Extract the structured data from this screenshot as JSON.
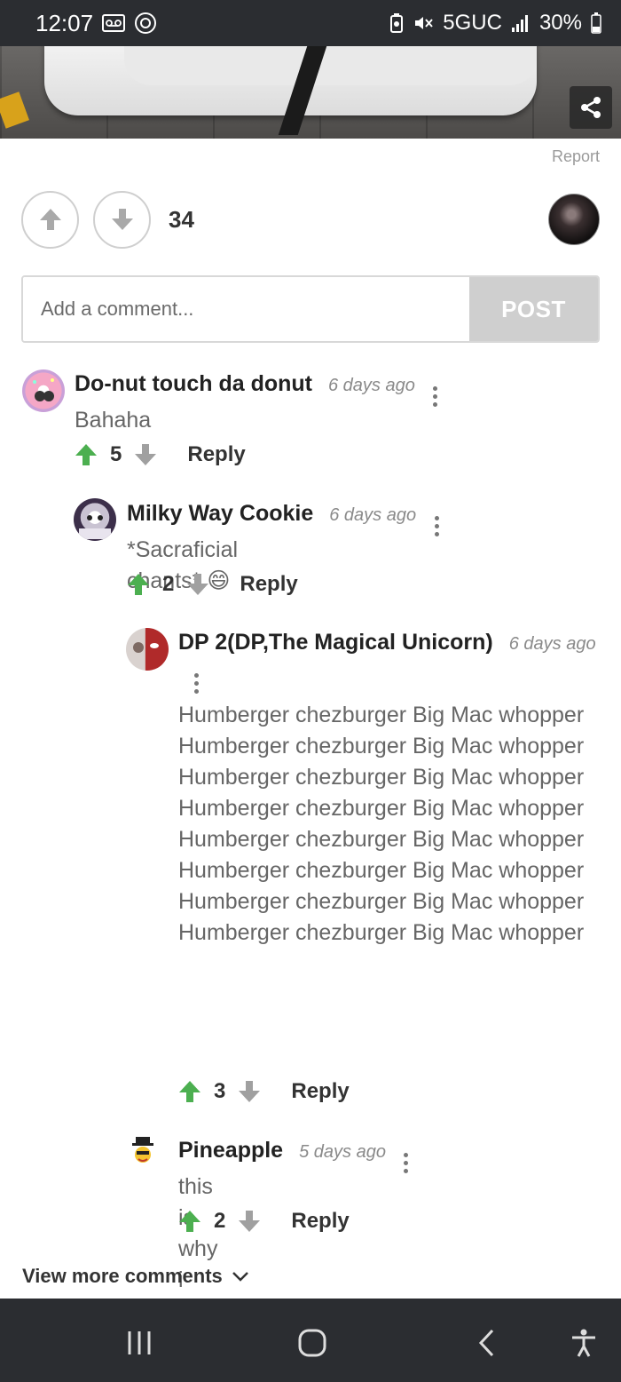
{
  "status_bar": {
    "time": "12:07",
    "network": "5GUC",
    "battery": "30%"
  },
  "post": {
    "report_label": "Report",
    "score": "34"
  },
  "comment_box": {
    "placeholder": "Add a comment...",
    "post_label": "POST"
  },
  "comments": [
    {
      "author": "Do-nut touch da donut",
      "time": "6 days ago",
      "text": "Bahaha",
      "votes": "5",
      "reply_label": "Reply"
    },
    {
      "author": "Milky Way Cookie",
      "time": "6 days ago",
      "text": "*Sacraficial chants* 😄",
      "votes": "2",
      "reply_label": "Reply"
    },
    {
      "author": "DP 2(DP,The Magical Unicorn)",
      "time": "6 days ago",
      "text": "Humberger chezburger Big Mac whopper Humberger chezburger Big Mac whopper Humberger chezburger Big Mac whopper Humberger chezburger Big Mac whopper Humberger chezburger Big Mac whopper Humberger chezburger Big Mac whopper Humberger chezburger Big Mac whopper Humberger chezburger Big Mac whopper",
      "votes": "3",
      "reply_label": "Reply"
    },
    {
      "author": "Pineapple",
      "time": "5 days ago",
      "text": "this is why i love bp",
      "votes": "2",
      "reply_label": "Reply"
    }
  ],
  "view_more_label": "View more comments",
  "colors": {
    "upvote_green": "#4caf50",
    "downvote_grey": "#a0a0a0",
    "system_bar": "#2b2d31"
  }
}
